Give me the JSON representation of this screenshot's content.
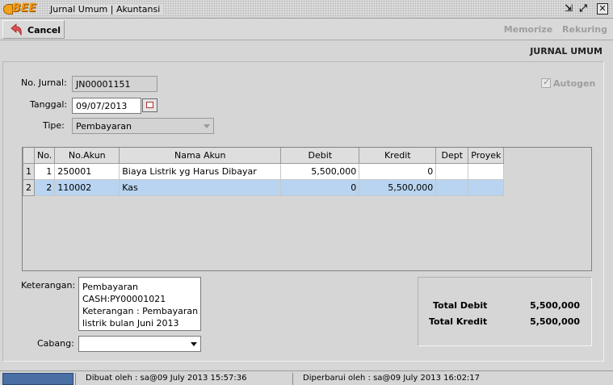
{
  "window": {
    "logo_text": "BEE",
    "title": "Jurnal Umum | Akuntansi",
    "restore_glyph": "⇲",
    "maximize_glyph": "⤢",
    "close_glyph": "✕"
  },
  "toolbar": {
    "cancel_label": "Cancel",
    "memorize_label": "Memorize",
    "rekuring_label": "Rekuring"
  },
  "form": {
    "title": "JURNAL UMUM",
    "no_jurnal_label": "No. Jurnal:",
    "no_jurnal_value": "JN00001151",
    "tanggal_label": "Tanggal:",
    "tanggal_value": "09/07/2013",
    "tipe_label": "Tipe:",
    "tipe_value": "Pembayaran",
    "autogen_label": "Autogen",
    "autogen_checked": true
  },
  "table": {
    "headers": [
      "No.",
      "No.Akun",
      "Nama Akun",
      "Debit",
      "Kredit",
      "Dept",
      "Proyek"
    ],
    "rows": [
      {
        "row_num": "1",
        "no": "1",
        "no_akun": "250001",
        "nama_akun": "Biaya Listrik yg Harus Dibayar",
        "debit": "5,500,000",
        "kredit": "0",
        "dept": "",
        "proyek": ""
      },
      {
        "row_num": "2",
        "no": "2",
        "no_akun": "110002",
        "nama_akun": "Kas",
        "debit": "0",
        "kredit": "5,500,000",
        "dept": "",
        "proyek": ""
      }
    ],
    "selected_row": 1
  },
  "keterangan": {
    "label": "Keterangan:",
    "lines": [
      "Pembayaran",
      "CASH:PY00001021",
      "Keterangan : Pembayaran",
      "listrik bulan Juni 2013"
    ]
  },
  "cabang": {
    "label": "Cabang:",
    "value": ""
  },
  "totals": {
    "debit_label": "Total Debit",
    "debit_value": "5,500,000",
    "kredit_label": "Total Kredit",
    "kredit_value": "5,500,000"
  },
  "status": {
    "dibuat": "Dibuat oleh : sa@09 July 2013  15:57:36",
    "diperbarui": "Diperbarui oleh : sa@09 July 2013  16:02:17"
  },
  "colors": {
    "selected_row": "#b8d4f0",
    "status_blue": "#4a6fa5",
    "logo_orange": "#f29a12"
  }
}
